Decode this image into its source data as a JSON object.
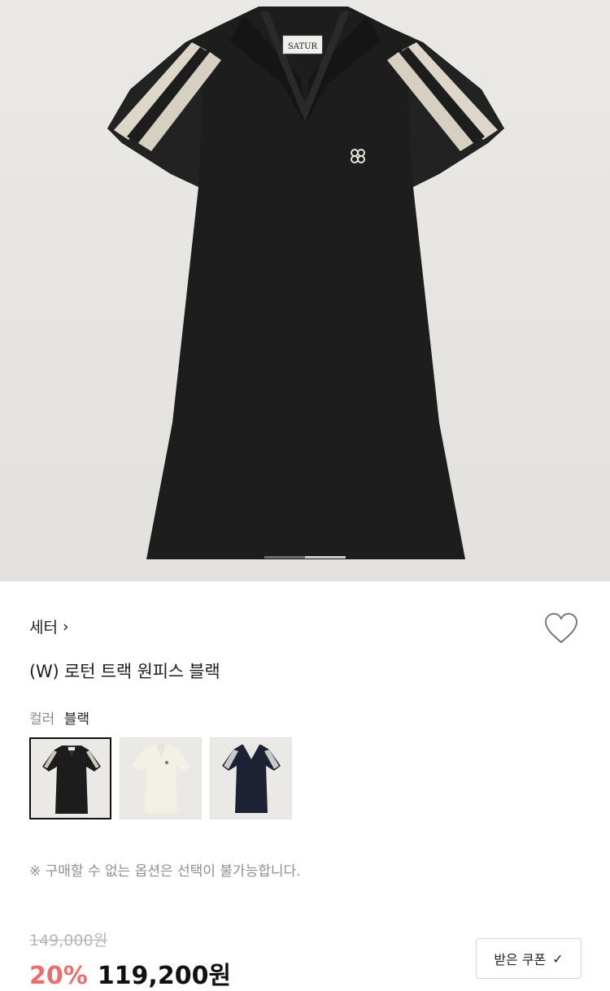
{
  "brand": {
    "name": "세터",
    "chevron": "›"
  },
  "product": {
    "title": "(W) 로턴 트랙 원피스 블랙"
  },
  "hero": {
    "label_text": "SATUR",
    "current_slide": 1,
    "total_slides": 2
  },
  "color": {
    "label": "컬러",
    "selected": "블랙",
    "swatches": [
      {
        "name": "black",
        "body": "#1c1c1c",
        "stripe": "#cfc9bc",
        "selected": true
      },
      {
        "name": "cream",
        "body": "#f3f0e6",
        "stripe": "#f3f0e6",
        "selected": false
      },
      {
        "name": "navy",
        "body": "#1b2233",
        "stripe": "#c9c9c9",
        "selected": false
      }
    ]
  },
  "notice": "※ 구매할 수 없는 옵션은 선택이 불가능합니다.",
  "price": {
    "original": "149,000원",
    "discount": "20%",
    "sale": "119,200원"
  },
  "coupon": {
    "label": "받은 쿠폰",
    "check": "✓"
  },
  "icons": {
    "wishlist": "heart-icon"
  },
  "colors": {
    "discount": "#e86f6f",
    "background": "#ffffff"
  }
}
